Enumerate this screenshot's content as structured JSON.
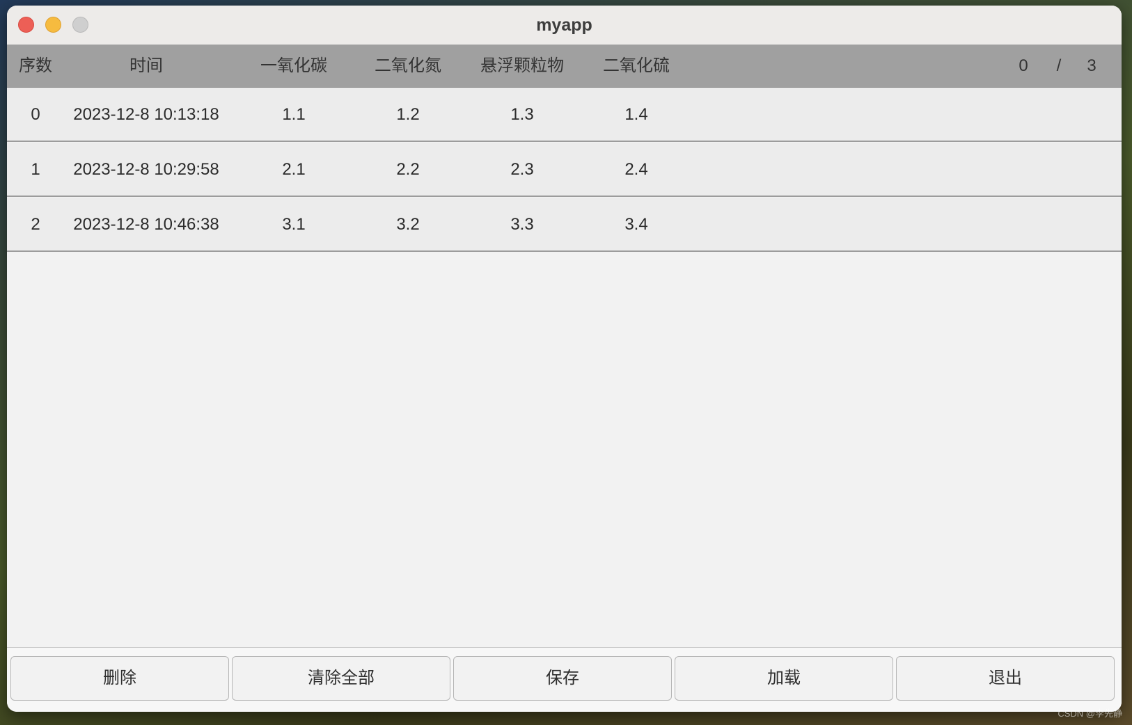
{
  "window": {
    "title": "myapp"
  },
  "table": {
    "columns": [
      "序数",
      "时间",
      "一氧化碳",
      "二氧化氮",
      "悬浮颗粒物",
      "二氧化硫"
    ],
    "pagination": {
      "current": "0",
      "separator": "/",
      "total": "3"
    },
    "rows": [
      {
        "index": "0",
        "time": "2023-12-8 10:13:18",
        "co": "1.1",
        "no2": "1.2",
        "pm": "1.3",
        "so2": "1.4"
      },
      {
        "index": "1",
        "time": "2023-12-8 10:29:58",
        "co": "2.1",
        "no2": "2.2",
        "pm": "2.3",
        "so2": "2.4"
      },
      {
        "index": "2",
        "time": "2023-12-8 10:46:38",
        "co": "3.1",
        "no2": "3.2",
        "pm": "3.3",
        "so2": "3.4"
      }
    ]
  },
  "buttons": {
    "delete": "删除",
    "clear_all": "清除全部",
    "save": "保存",
    "load": "加载",
    "exit": "退出"
  },
  "watermark": "CSDN @李先静",
  "colors": {
    "close": "#ed5f56",
    "minimize": "#f6bb3f",
    "maximize": "#cfcfcf",
    "header_bg": "#a0a0a0"
  }
}
